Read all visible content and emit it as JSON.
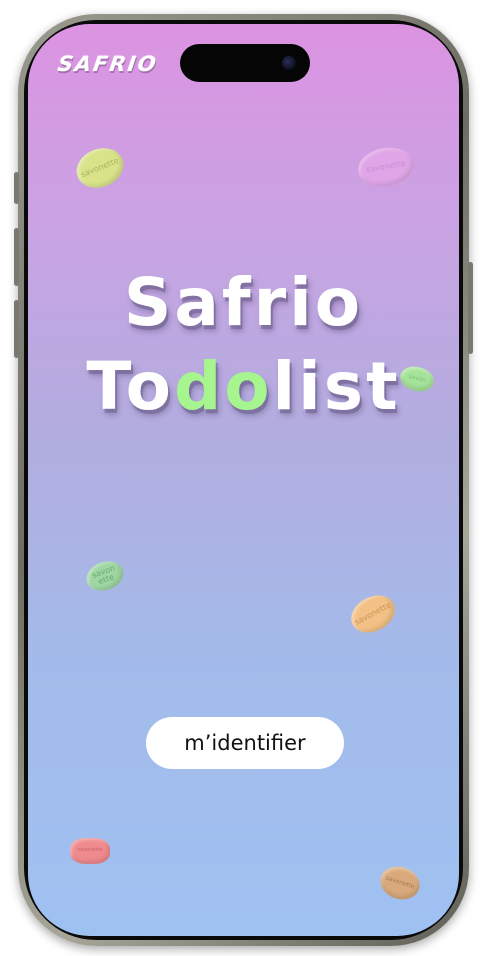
{
  "brand": {
    "logo_text": "SAFRIO"
  },
  "title": {
    "line1": "Safrio",
    "line2_a": "To",
    "line2_b": "do",
    "line2_c": "list"
  },
  "soaps": [
    {
      "label": "savonette",
      "color": "#d9e48a",
      "text_color": "#a9b45a"
    },
    {
      "label": "savonette",
      "color": "#e4a7e8",
      "text_color": "#c78ad0"
    },
    {
      "label": "savon",
      "color": "#a6e39a",
      "text_color": "#7fbf73"
    },
    {
      "label": "savon\nette",
      "color": "#9fd6a2",
      "text_color": "#6aa96f"
    },
    {
      "label": "savonette",
      "color": "#f3c185",
      "text_color": "#c99558"
    },
    {
      "label": "savonette",
      "color": "#ef8a8e",
      "text_color": "#c86468"
    },
    {
      "label": "savonette",
      "color": "#d9a97c",
      "text_color": "#a77a50"
    }
  ],
  "login_button": {
    "label": "m’identifier"
  },
  "colors": {
    "gradient_top": "#dc93e1",
    "gradient_bottom": "#9fc1f2",
    "accent": "#a6f58f"
  }
}
